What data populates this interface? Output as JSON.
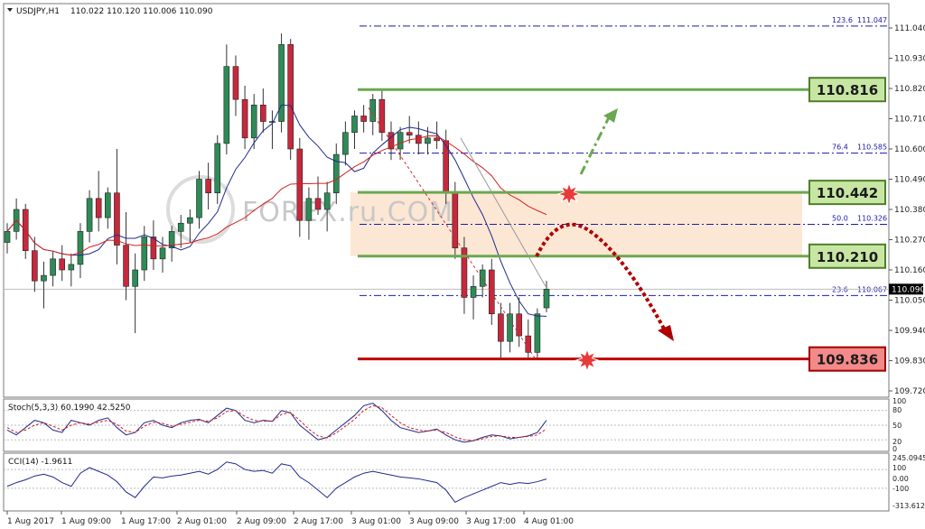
{
  "symbol": "USDJPY,H1",
  "ohlc": "110.022 110.120 110.006 110.090",
  "watermark": "FOREX.ru.COM",
  "colors": {
    "bull": "#2e8b57",
    "bear": "#c8283c",
    "ma_fast": "#1f2a8a",
    "ma_slow": "#d42020",
    "green_line": "#6aa84f",
    "red_line": "#c00000",
    "zone": "#fbe3cc",
    "fib": "#1a1aa8"
  },
  "chart_data": [
    {
      "type": "candlestick",
      "ylim": [
        109.72,
        111.1
      ],
      "y_ticks": [
        "111.040",
        "110.930",
        "110.820",
        "110.710",
        "110.600",
        "110.490",
        "110.380",
        "110.270",
        "110.160",
        "110.050",
        "109.940",
        "109.830",
        "109.720"
      ],
      "current_price": "110.090",
      "x_ticks": [
        "1 Aug 2017",
        "1 Aug 09:00",
        "1 Aug 17:00",
        "2 Aug 01:00",
        "2 Aug 09:00",
        "2 Aug 17:00",
        "3 Aug 01:00",
        "3 Aug 09:00",
        "3 Aug 17:00",
        "4 Aug 01:00"
      ],
      "candles": [
        [
          110.26,
          110.33,
          110.22,
          110.3
        ],
        [
          110.3,
          110.42,
          110.27,
          110.38
        ],
        [
          110.38,
          110.4,
          110.2,
          110.23
        ],
        [
          110.23,
          110.28,
          110.08,
          110.12
        ],
        [
          110.12,
          110.19,
          110.02,
          110.14
        ],
        [
          110.14,
          110.23,
          110.1,
          110.2
        ],
        [
          110.2,
          110.25,
          110.12,
          110.16
        ],
        [
          110.16,
          110.22,
          110.1,
          110.18
        ],
        [
          110.18,
          110.33,
          110.13,
          110.3
        ],
        [
          110.3,
          110.45,
          110.26,
          110.42
        ],
        [
          110.42,
          110.52,
          110.3,
          110.35
        ],
        [
          110.35,
          110.46,
          110.31,
          110.44
        ],
        [
          110.44,
          110.6,
          110.18,
          110.25
        ],
        [
          110.25,
          110.37,
          110.05,
          110.1
        ],
        [
          110.1,
          110.22,
          109.93,
          110.16
        ],
        [
          110.16,
          110.32,
          110.12,
          110.28
        ],
        [
          110.28,
          110.34,
          110.16,
          110.2
        ],
        [
          110.2,
          110.28,
          110.15,
          110.24
        ],
        [
          110.24,
          110.32,
          110.19,
          110.3
        ],
        [
          110.3,
          110.36,
          110.24,
          110.33
        ],
        [
          110.33,
          110.38,
          110.26,
          110.35
        ],
        [
          110.35,
          110.52,
          110.31,
          110.49
        ],
        [
          110.49,
          110.55,
          110.38,
          110.44
        ],
        [
          110.44,
          110.65,
          110.4,
          110.62
        ],
        [
          110.62,
          110.98,
          110.58,
          110.9
        ],
        [
          110.9,
          110.94,
          110.72,
          110.78
        ],
        [
          110.78,
          110.83,
          110.6,
          110.64
        ],
        [
          110.64,
          110.8,
          110.6,
          110.76
        ],
        [
          110.76,
          110.82,
          110.66,
          110.7
        ],
        [
          110.7,
          110.74,
          110.6,
          110.7
        ],
        [
          110.7,
          111.02,
          110.66,
          110.98
        ],
        [
          110.98,
          111.0,
          110.56,
          110.6
        ],
        [
          110.6,
          110.64,
          110.28,
          110.34
        ],
        [
          110.34,
          110.46,
          110.27,
          110.42
        ],
        [
          110.42,
          110.5,
          110.36,
          110.38
        ],
        [
          110.38,
          110.48,
          110.3,
          110.44
        ],
        [
          110.44,
          110.62,
          110.4,
          110.58
        ],
        [
          110.58,
          110.7,
          110.54,
          110.66
        ],
        [
          110.66,
          110.74,
          110.6,
          110.72
        ],
        [
          110.72,
          110.76,
          110.66,
          110.7
        ],
        [
          110.7,
          110.8,
          110.65,
          110.78
        ],
        [
          110.78,
          110.82,
          110.63,
          110.66
        ],
        [
          110.66,
          110.7,
          110.56,
          110.6
        ],
        [
          110.6,
          110.68,
          110.56,
          110.66
        ],
        [
          110.66,
          110.72,
          110.62,
          110.65
        ],
        [
          110.65,
          110.7,
          110.58,
          110.62
        ],
        [
          110.62,
          110.68,
          110.58,
          110.64
        ],
        [
          110.64,
          110.7,
          110.6,
          110.63
        ],
        [
          110.63,
          110.67,
          110.4,
          110.44
        ],
        [
          110.44,
          110.48,
          110.2,
          110.24
        ],
        [
          110.24,
          110.28,
          110.0,
          110.06
        ],
        [
          110.06,
          110.14,
          109.98,
          110.1
        ],
        [
          110.1,
          110.18,
          110.06,
          110.16
        ],
        [
          110.16,
          110.2,
          109.96,
          110.0
        ],
        [
          110.0,
          110.04,
          109.84,
          109.9
        ],
        [
          109.9,
          110.04,
          109.86,
          110.0
        ],
        [
          110.0,
          110.06,
          109.88,
          109.92
        ],
        [
          109.92,
          109.98,
          109.84,
          109.86
        ],
        [
          109.86,
          110.02,
          109.84,
          110.0
        ],
        [
          110.022,
          110.12,
          110.006,
          110.09
        ]
      ],
      "levels": [
        {
          "value": 110.816,
          "label": "110.816",
          "kind": "resistance"
        },
        {
          "value": 110.442,
          "label": "110.442",
          "kind": "resistance"
        },
        {
          "value": 110.21,
          "label": "110.210",
          "kind": "support"
        },
        {
          "value": 109.836,
          "label": "109.836",
          "kind": "target"
        }
      ],
      "fib_levels": [
        {
          "pct": "123.6",
          "value": 111.047,
          "label": "111.047"
        },
        {
          "pct": "76.4",
          "value": 110.585,
          "label": "110.585"
        },
        {
          "pct": "50.0",
          "value": 110.326,
          "label": "110.326"
        },
        {
          "pct": "23.6",
          "value": 110.067,
          "label": "110.067"
        }
      ],
      "zone": [
        110.21,
        110.442
      ]
    },
    {
      "type": "line",
      "title": "Stoch(5,3,3) 60.1990 42.5250",
      "ylim": [
        0,
        100
      ],
      "y_ticks": [
        "100",
        "80",
        "50",
        "20",
        "0"
      ],
      "series": [
        {
          "name": "60.1990",
          "values": [
            40,
            30,
            45,
            60,
            55,
            40,
            35,
            60,
            55,
            50,
            60,
            65,
            45,
            30,
            35,
            55,
            60,
            50,
            45,
            55,
            60,
            62,
            55,
            70,
            85,
            80,
            60,
            55,
            60,
            58,
            80,
            75,
            50,
            35,
            20,
            25,
            40,
            55,
            70,
            90,
            95,
            80,
            60,
            45,
            40,
            35,
            38,
            42,
            30,
            20,
            15,
            18,
            25,
            30,
            28,
            22,
            25,
            28,
            35,
            60
          ]
        },
        {
          "name": "42.5250",
          "values": [
            45,
            35,
            40,
            50,
            55,
            48,
            40,
            50,
            55,
            52,
            56,
            60,
            52,
            38,
            35,
            48,
            56,
            54,
            48,
            52,
            56,
            60,
            58,
            65,
            78,
            80,
            68,
            60,
            58,
            58,
            72,
            76,
            60,
            42,
            28,
            24,
            34,
            48,
            62,
            80,
            90,
            86,
            70,
            55,
            45,
            40,
            38,
            40,
            35,
            26,
            20,
            18,
            22,
            27,
            28,
            25,
            25,
            27,
            30,
            42.5
          ]
        }
      ]
    },
    {
      "type": "line",
      "title": "CCI(14) -1.9611",
      "ylim": [
        -313.612,
        245.095
      ],
      "y_ticks": [
        "245.0945",
        "100",
        "0.00",
        "-100",
        "-313.612"
      ],
      "series": [
        {
          "name": "-1.9611",
          "values": [
            -80,
            -40,
            -10,
            30,
            50,
            20,
            -40,
            -80,
            60,
            120,
            80,
            40,
            -30,
            -140,
            -200,
            -80,
            20,
            10,
            30,
            40,
            60,
            80,
            50,
            100,
            180,
            160,
            100,
            80,
            90,
            60,
            160,
            140,
            20,
            -40,
            -120,
            -200,
            -100,
            -40,
            20,
            60,
            80,
            60,
            40,
            20,
            10,
            0,
            -20,
            -40,
            -120,
            -250,
            -200,
            -160,
            -120,
            -80,
            -40,
            -60,
            -40,
            -50,
            -30,
            -2
          ]
        }
      ]
    }
  ]
}
